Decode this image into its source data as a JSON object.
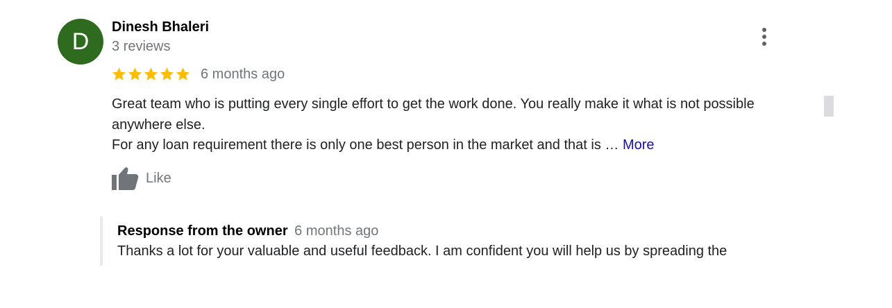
{
  "review": {
    "avatar_letter": "D",
    "author_name": "Dinesh Bhaleri",
    "review_count": "3 reviews",
    "rating": 5,
    "date": "6 months ago",
    "text_line1": "Great team who is putting every single effort to get the work done. You really make it what is not possible anywhere else.",
    "text_line2": "For any loan requirement there is only one best person in the market and that is … ",
    "more_label": "More",
    "like_label": "Like"
  },
  "owner_response": {
    "title": "Response from the owner",
    "date": "6 months ago",
    "text": "Thanks a lot for your valuable and useful feedback. I am confident you will help us by spreading the"
  },
  "icons": {
    "menu": "more-vertical-icon",
    "star": "star-icon",
    "like": "thumbs-up-icon"
  },
  "colors": {
    "avatar_bg": "#2e6b1f",
    "star": "#fbbc04",
    "link": "#1a0dab",
    "secondary_text": "#70757a"
  }
}
